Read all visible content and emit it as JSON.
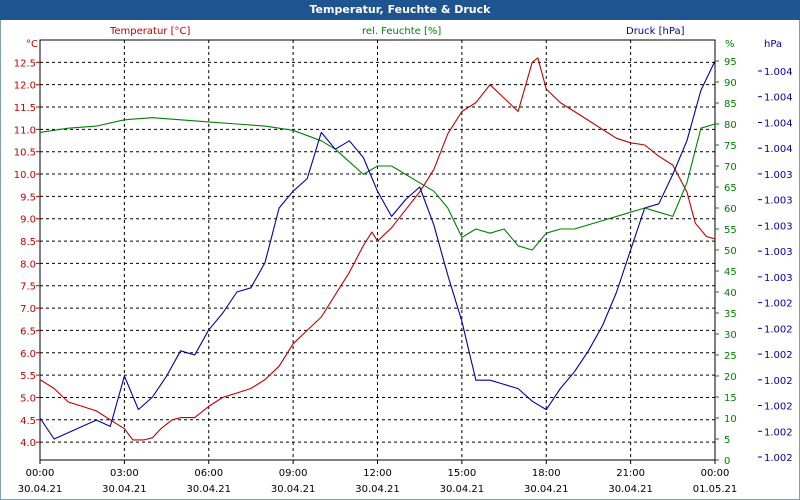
{
  "window": {
    "title": "Temperatur, Feuchte & Druck"
  },
  "colors": {
    "temperature": "#c00000",
    "humidity": "#008000",
    "pressure": "#0000a0",
    "grid": "#000000",
    "titlebar": "#1e5591"
  },
  "chart_data": {
    "type": "line",
    "title": "Temperatur, Feuchte & Druck",
    "grid": true,
    "x_ticks": [
      {
        "hour": 0,
        "time": "00:00",
        "date": "30.04.21"
      },
      {
        "hour": 3,
        "time": "03:00",
        "date": "30.04.21"
      },
      {
        "hour": 6,
        "time": "06:00",
        "date": "30.04.21"
      },
      {
        "hour": 9,
        "time": "09:00",
        "date": "30.04.21"
      },
      {
        "hour": 12,
        "time": "12:00",
        "date": "30.04.21"
      },
      {
        "hour": 15,
        "time": "15:00",
        "date": "30.04.21"
      },
      {
        "hour": 18,
        "time": "18:00",
        "date": "30.04.21"
      },
      {
        "hour": 21,
        "time": "21:00",
        "date": "30.04.21"
      },
      {
        "hour": 24,
        "time": "00:00",
        "date": "01.05.21"
      }
    ],
    "axes": {
      "temperature": {
        "unit": "°C",
        "min": 3.6,
        "max": 13.0,
        "ticks": [
          "4.0",
          "4.5",
          "5.0",
          "5.5",
          "6.0",
          "6.5",
          "7.0",
          "7.5",
          "8.0",
          "8.5",
          "9.0",
          "9.5",
          "10.0",
          "10.5",
          "11.0",
          "11.5",
          "12.0",
          "12.5"
        ]
      },
      "humidity": {
        "unit": "%",
        "min": 0,
        "max": 100,
        "ticks": [
          "0",
          "5",
          "10",
          "15",
          "20",
          "25",
          "30",
          "35",
          "40",
          "45",
          "50",
          "55",
          "60",
          "65",
          "70",
          "75",
          "80",
          "85",
          "90",
          "95"
        ]
      },
      "pressure": {
        "unit": "hPa",
        "ticks": [
          "1.002",
          "1.002",
          "1.002",
          "1.002",
          "1.002",
          "1.002",
          "1.002",
          "1.003",
          "1.003",
          "1.003",
          "1.003",
          "1.003",
          "1.004",
          "1.004",
          "1.004",
          "1.004"
        ]
      }
    },
    "series": [
      {
        "name": "Temperatur [°C]",
        "axis": "temperature",
        "points": [
          [
            0,
            5.4
          ],
          [
            0.5,
            5.2
          ],
          [
            1,
            4.9
          ],
          [
            1.5,
            4.8
          ],
          [
            2,
            4.7
          ],
          [
            2.5,
            4.5
          ],
          [
            3,
            4.3
          ],
          [
            3.3,
            4.05
          ],
          [
            3.7,
            4.05
          ],
          [
            4,
            4.1
          ],
          [
            4.3,
            4.3
          ],
          [
            4.7,
            4.5
          ],
          [
            5,
            4.55
          ],
          [
            5.5,
            4.55
          ],
          [
            6,
            4.8
          ],
          [
            6.5,
            5.0
          ],
          [
            7,
            5.1
          ],
          [
            7.5,
            5.2
          ],
          [
            8,
            5.4
          ],
          [
            8.5,
            5.7
          ],
          [
            9,
            6.2
          ],
          [
            9.5,
            6.5
          ],
          [
            10,
            6.8
          ],
          [
            10.5,
            7.3
          ],
          [
            11,
            7.8
          ],
          [
            11.5,
            8.4
          ],
          [
            11.8,
            8.7
          ],
          [
            12,
            8.5
          ],
          [
            12.5,
            8.8
          ],
          [
            13,
            9.2
          ],
          [
            13.5,
            9.6
          ],
          [
            14,
            10.1
          ],
          [
            14.5,
            10.9
          ],
          [
            15,
            11.4
          ],
          [
            15.5,
            11.6
          ],
          [
            16,
            12.0
          ],
          [
            16.5,
            11.7
          ],
          [
            17,
            11.4
          ],
          [
            17.5,
            12.5
          ],
          [
            17.7,
            12.6
          ],
          [
            18,
            11.9
          ],
          [
            18.5,
            11.6
          ],
          [
            19,
            11.4
          ],
          [
            19.5,
            11.2
          ],
          [
            20,
            11.0
          ],
          [
            20.5,
            10.8
          ],
          [
            21,
            10.7
          ],
          [
            21.5,
            10.65
          ],
          [
            22,
            10.4
          ],
          [
            22.5,
            10.2
          ],
          [
            23,
            9.6
          ],
          [
            23.3,
            8.9
          ],
          [
            23.7,
            8.6
          ],
          [
            24,
            8.55
          ]
        ]
      },
      {
        "name": "rel. Feuchte [%]",
        "axis": "humidity",
        "points": [
          [
            0,
            78
          ],
          [
            1,
            79
          ],
          [
            2,
            79.5
          ],
          [
            3,
            81
          ],
          [
            4,
            81.5
          ],
          [
            5,
            81
          ],
          [
            6,
            80.5
          ],
          [
            7,
            80
          ],
          [
            8,
            79.5
          ],
          [
            9,
            78.5
          ],
          [
            10,
            76
          ],
          [
            10.5,
            74
          ],
          [
            11,
            71
          ],
          [
            11.5,
            68
          ],
          [
            12,
            70
          ],
          [
            12.5,
            70
          ],
          [
            13,
            68
          ],
          [
            13.5,
            66
          ],
          [
            14,
            64
          ],
          [
            14.5,
            60
          ],
          [
            15,
            53
          ],
          [
            15.5,
            55
          ],
          [
            16,
            54
          ],
          [
            16.5,
            55
          ],
          [
            17,
            51
          ],
          [
            17.5,
            50
          ],
          [
            18,
            54
          ],
          [
            18.5,
            55
          ],
          [
            19,
            55
          ],
          [
            20,
            57
          ],
          [
            21,
            59
          ],
          [
            21.5,
            60
          ],
          [
            22,
            59
          ],
          [
            22.5,
            58
          ],
          [
            23,
            66
          ],
          [
            23.5,
            79
          ],
          [
            24,
            80
          ]
        ]
      },
      {
        "name": "Druck [hPa]",
        "axis": "pressure",
        "points": [
          [
            0,
            10
          ],
          [
            0.5,
            5
          ],
          [
            1,
            6.5
          ],
          [
            1.5,
            8
          ],
          [
            2,
            9.5
          ],
          [
            2.5,
            8
          ],
          [
            3,
            20
          ],
          [
            3.5,
            12
          ],
          [
            4,
            15
          ],
          [
            4.5,
            20
          ],
          [
            5,
            26
          ],
          [
            5.5,
            25
          ],
          [
            6,
            31
          ],
          [
            6.5,
            35
          ],
          [
            7,
            40
          ],
          [
            7.5,
            41
          ],
          [
            8,
            47
          ],
          [
            8.5,
            60
          ],
          [
            9,
            64
          ],
          [
            9.5,
            67
          ],
          [
            10,
            78
          ],
          [
            10.5,
            74
          ],
          [
            11,
            76
          ],
          [
            11.5,
            72
          ],
          [
            12,
            64
          ],
          [
            12.5,
            58
          ],
          [
            13,
            62
          ],
          [
            13.5,
            65
          ],
          [
            14,
            56
          ],
          [
            14.5,
            44
          ],
          [
            15,
            33
          ],
          [
            15.5,
            19
          ],
          [
            16,
            19
          ],
          [
            16.5,
            18
          ],
          [
            17,
            17
          ],
          [
            17.5,
            14
          ],
          [
            18,
            12
          ],
          [
            18.5,
            17
          ],
          [
            19,
            21
          ],
          [
            19.5,
            26
          ],
          [
            20,
            32
          ],
          [
            20.5,
            40
          ],
          [
            21,
            50
          ],
          [
            21.5,
            60
          ],
          [
            22,
            61
          ],
          [
            22.5,
            68
          ],
          [
            23,
            76
          ],
          [
            23.5,
            88
          ],
          [
            24,
            95
          ]
        ]
      }
    ]
  }
}
